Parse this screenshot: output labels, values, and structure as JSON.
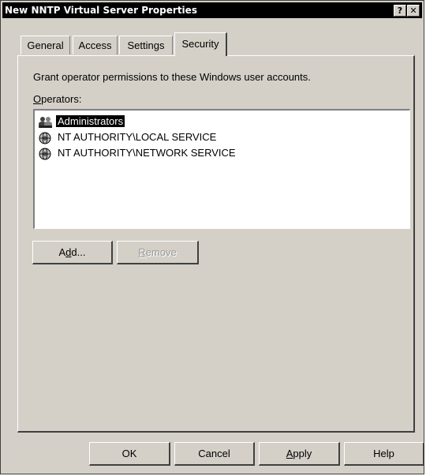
{
  "window": {
    "title": "New NNTP Virtual Server Properties",
    "help_label": "?",
    "close_label": "✕"
  },
  "tabs": [
    {
      "label": "General"
    },
    {
      "label": "Access"
    },
    {
      "label": "Settings"
    },
    {
      "label": "Security",
      "active": true
    }
  ],
  "security": {
    "description": "Grant operator permissions to these Windows user accounts.",
    "operators_label_first": "O",
    "operators_label_rest": "perators:",
    "operators": [
      {
        "name": "Administrators",
        "icon": "group-icon",
        "selected": true
      },
      {
        "name": "NT AUTHORITY\\LOCAL SERVICE",
        "icon": "globe-icon"
      },
      {
        "name": "NT AUTHORITY\\NETWORK SERVICE",
        "icon": "globe-icon"
      }
    ],
    "add_pre": "A",
    "add_ul": "d",
    "add_post": "d...",
    "remove_ul": "R",
    "remove_post": "emove"
  },
  "footer": {
    "ok": "OK",
    "cancel": "Cancel",
    "apply_ul": "A",
    "apply_post": "pply",
    "help": "Help"
  }
}
